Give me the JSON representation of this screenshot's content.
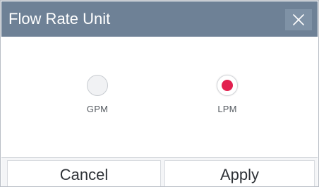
{
  "dialog": {
    "title": "Flow Rate Unit",
    "close_icon": "close-icon"
  },
  "options": [
    {
      "label": "GPM",
      "selected": false
    },
    {
      "label": "LPM",
      "selected": true
    }
  ],
  "buttons": {
    "cancel_label": "Cancel",
    "apply_label": "Apply"
  },
  "colors": {
    "titlebar": "#6e8196",
    "selected_dot": "#e2204f"
  }
}
